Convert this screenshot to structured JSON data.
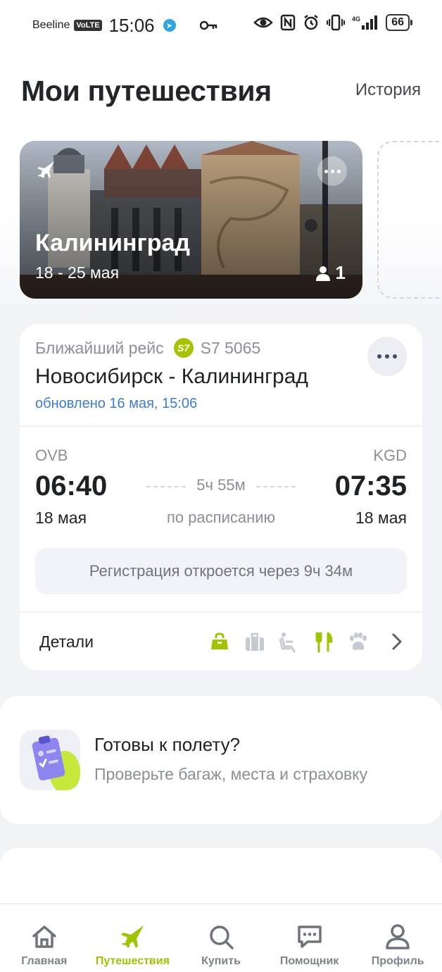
{
  "status_bar": {
    "carrier": "Beeline",
    "volte": "VoLTE",
    "time": "15:06",
    "battery": "66",
    "network": "4G"
  },
  "header": {
    "title": "Мои путешествия",
    "history_link": "История"
  },
  "trip_card": {
    "city": "Калининград",
    "dates": "18 - 25 мая",
    "travelers": "1"
  },
  "flight": {
    "caption": "Ближайший рейс",
    "flight_number": "S7 5065",
    "airline_logo_text": "S7",
    "route": "Новосибирск - Калининград",
    "updated": "обновлено 16 мая, 15:06",
    "departure": {
      "code": "OVB",
      "time": "06:40",
      "date": "18 мая"
    },
    "arrival": {
      "code": "KGD",
      "time": "07:35",
      "date": "18 мая"
    },
    "duration": "5ч 55м",
    "status": "по расписанию",
    "registration_notice": "Регистрация откроется через 9ч 34м",
    "details_label": "Детали",
    "amenities": [
      "hand-luggage-icon",
      "baggage-icon",
      "seat-icon",
      "meal-icon",
      "pet-icon"
    ],
    "amenity_colors": {
      "active": "#9ec400",
      "inactive": "#c5c9d1"
    }
  },
  "ready_card": {
    "title": "Готовы к полету?",
    "subtitle": "Проверьте багаж, места и страховку"
  },
  "bottom_nav": {
    "items": [
      {
        "label": "Главная",
        "icon": "home-icon",
        "active": false
      },
      {
        "label": "Путешествия",
        "icon": "plane-icon",
        "active": true
      },
      {
        "label": "Купить",
        "icon": "search-icon",
        "active": false
      },
      {
        "label": "Помощник",
        "icon": "chat-icon",
        "active": false
      },
      {
        "label": "Профиль",
        "icon": "profile-icon",
        "active": false
      }
    ]
  },
  "colors": {
    "accent": "#9ec400",
    "link": "#3d7bd6",
    "text": "#1e2126",
    "muted": "#8a8f98"
  }
}
